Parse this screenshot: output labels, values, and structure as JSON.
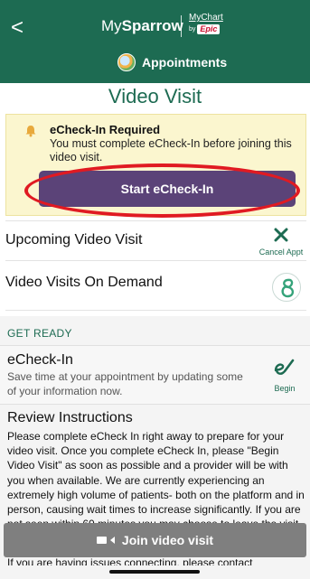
{
  "header": {
    "back_glyph": "<",
    "brand_prefix": "My",
    "brand_bold": "Sparrow",
    "mychart_label": "MyChart",
    "mychart_by": "by",
    "mychart_epic": "Epic",
    "section_label": "Appointments",
    "background_color": "#1d6b52"
  },
  "page": {
    "title": "Video Visit"
  },
  "banner": {
    "title": "eCheck-In Required",
    "message": "You must complete eCheck-In before joining this video visit.",
    "button_label": "Start eCheck-In",
    "button_color": "#5b4378",
    "annotation_color": "#e01a22"
  },
  "rows": [
    {
      "title": "Upcoming Video Visit",
      "action_label": "Cancel Appt"
    },
    {
      "title": "Video Visits On Demand"
    }
  ],
  "get_ready": {
    "heading": "GET READY",
    "echeck": {
      "title": "eCheck-In",
      "description": "Save time at your appointment by updating some of your information now.",
      "action_label": "Begin"
    },
    "review": {
      "title": "Review Instructions",
      "text": "Please complete eCheck In right away to prepare for your video visit.  Once you complete eCheck In, please \"Begin Video Visit\" as soon as possible and a provider will be with you when available.  We are currently experiencing an extremely high volume of patients- both on the platform and in person, causing wait times to increase significantly.  If you are not seen within 60 minutes you may choose to leave the visit.",
      "partial_last_line": "If you are having issues connecting, please contact"
    }
  },
  "footer": {
    "join_label": "Join video visit"
  },
  "icons": {
    "back": "chevron-left-icon",
    "bell": "bell-icon",
    "cancel": "close-icon",
    "on_demand": "on-demand-icon",
    "begin": "echeck-icon",
    "camera": "video-camera-icon",
    "appointments": "appointments-icon"
  }
}
